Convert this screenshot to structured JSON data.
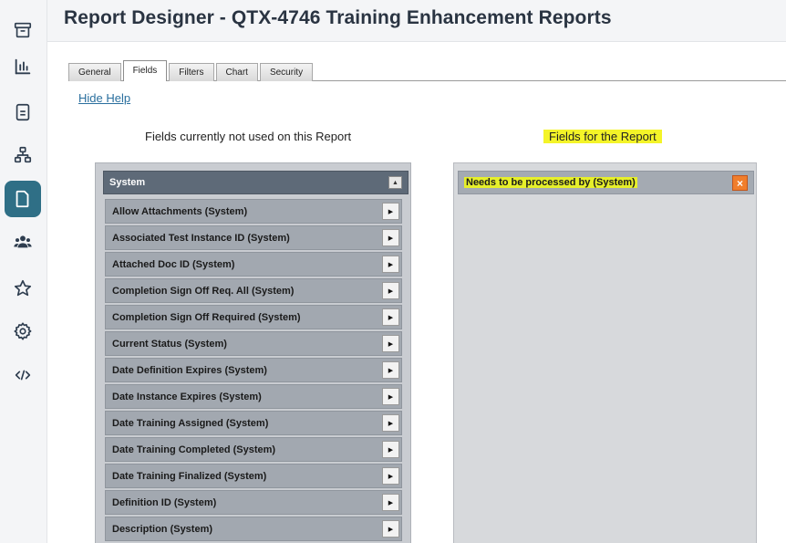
{
  "header": {
    "title": "Report Designer - QTX-4746 Training Enhancement Reports"
  },
  "rail": {
    "items": [
      {
        "icon": "archive-icon"
      },
      {
        "icon": "bar-chart-icon"
      },
      {
        "icon": "document-icon"
      },
      {
        "icon": "hierarchy-icon"
      },
      {
        "icon": "report-icon",
        "active": true
      },
      {
        "icon": "users-icon"
      },
      {
        "icon": "star-icon"
      },
      {
        "icon": "settings-icon"
      },
      {
        "icon": "code-icon"
      }
    ]
  },
  "tabs": [
    "General",
    "Fields",
    "Filters",
    "Chart",
    "Security"
  ],
  "active_tab": "Fields",
  "help_link": "Hide Help",
  "available": {
    "label": "Fields currently not used on this Report",
    "group_title": "System",
    "fields": [
      "Allow Attachments (System)",
      "Associated Test Instance ID (System)",
      "Attached Doc ID (System)",
      "Completion Sign Off Req. All (System)",
      "Completion Sign Off Required (System)",
      "Current Status (System)",
      "Date Definition Expires (System)",
      "Date Instance Expires (System)",
      "Date Training Assigned (System)",
      "Date Training Completed (System)",
      "Date Training Finalized (System)",
      "Definition ID (System)",
      "Description (System)"
    ]
  },
  "report": {
    "label": "Fields for the Report",
    "fields": [
      "Needs to be processed by (System)"
    ]
  },
  "colors": {
    "accent": "#2f6f86",
    "highlight": "#f4f428",
    "remove": "#f07e2c"
  }
}
